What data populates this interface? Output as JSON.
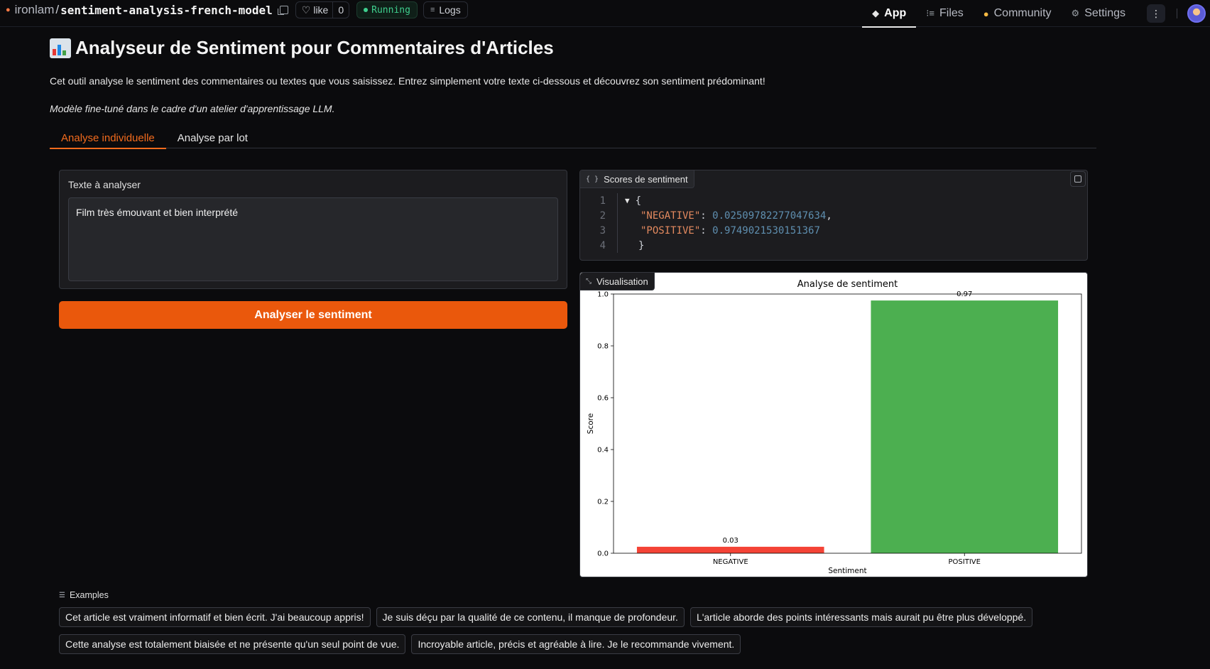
{
  "header": {
    "owner": "ironlam",
    "repo_name": "sentiment-analysis-french-model",
    "like_label": "like",
    "like_count": "0",
    "status": "Running",
    "logs_label": "Logs",
    "nav": [
      {
        "label": "App",
        "icon": "cube-icon"
      },
      {
        "label": "Files",
        "icon": "files-icon"
      },
      {
        "label": "Community",
        "icon": "community-icon"
      },
      {
        "label": "Settings",
        "icon": "gear-icon"
      }
    ]
  },
  "main": {
    "title": "Analyseur de Sentiment pour Commentaires d'Articles",
    "description": "Cet outil analyse le sentiment des commentaires ou textes que vous saisissez. Entrez simplement votre texte ci-dessous et découvrez son sentiment prédominant!",
    "note": "Modèle fine-tuné dans le cadre d'un atelier d'apprentissage LLM.",
    "tabs": [
      {
        "label": "Analyse individuelle",
        "active": true
      },
      {
        "label": "Analyse par lot",
        "active": false
      }
    ]
  },
  "input": {
    "label": "Texte à analyser",
    "value": "Film très émouvant et bien interprété"
  },
  "submit_label": "Analyser le sentiment",
  "json_output": {
    "label": "Scores de sentiment",
    "line_numbers": [
      "1",
      "2",
      "3",
      "4"
    ],
    "open_brace": "{",
    "close_brace": "}",
    "negative_key": "\"NEGATIVE\"",
    "negative_value": "0.02509782277047634",
    "positive_key": "\"POSITIVE\"",
    "positive_value": "0.9749021530151367"
  },
  "viz_label": "Visualisation",
  "chart_data": {
    "type": "bar",
    "title": "Analyse de sentiment",
    "xlabel": "Sentiment",
    "ylabel": "Score",
    "categories": [
      "NEGATIVE",
      "POSITIVE"
    ],
    "values": [
      0.025,
      0.975
    ],
    "data_labels": [
      "0.03",
      "0.97"
    ],
    "colors": [
      "#f44336",
      "#4caf50"
    ],
    "ylim": [
      0,
      1.0
    ],
    "yticks": [
      "0.0",
      "0.2",
      "0.4",
      "0.6",
      "0.8",
      "1.0"
    ],
    "grid": false,
    "legend": "none"
  },
  "examples": {
    "label": "Examples",
    "items": [
      "Cet article est vraiment informatif et bien écrit. J'ai beaucoup appris!",
      "Je suis déçu par la qualité de ce contenu, il manque de profondeur.",
      "L'article aborde des points intéressants mais aurait pu être plus développé.",
      "Cette analyse est totalement biaisée et ne présente qu'un seul point de vue.",
      "Incroyable article, précis et agréable à lire. Je le recommande vivement."
    ]
  }
}
